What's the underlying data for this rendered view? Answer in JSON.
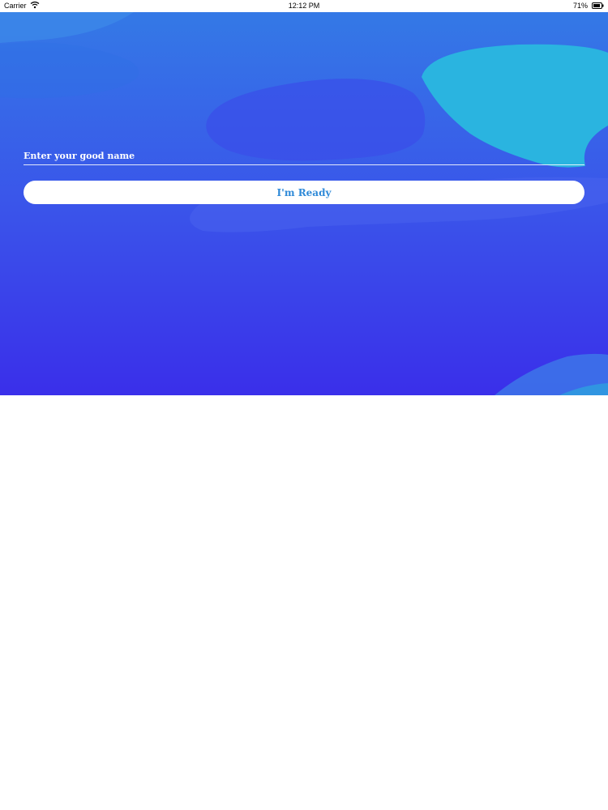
{
  "status_bar": {
    "carrier": "Carrier",
    "time": "12:12 PM",
    "battery_percent": "71%",
    "wifi_icon": "wifi-icon",
    "battery_icon": "battery-icon"
  },
  "form": {
    "name_placeholder": "Enter your good name",
    "name_value": "",
    "ready_button_label": "I'm Ready"
  },
  "colors": {
    "gradient_top": "#3479e6",
    "gradient_bottom": "#3a2fea",
    "button_text": "#2f8ad8",
    "accent_blob": "#2ab4e0"
  }
}
